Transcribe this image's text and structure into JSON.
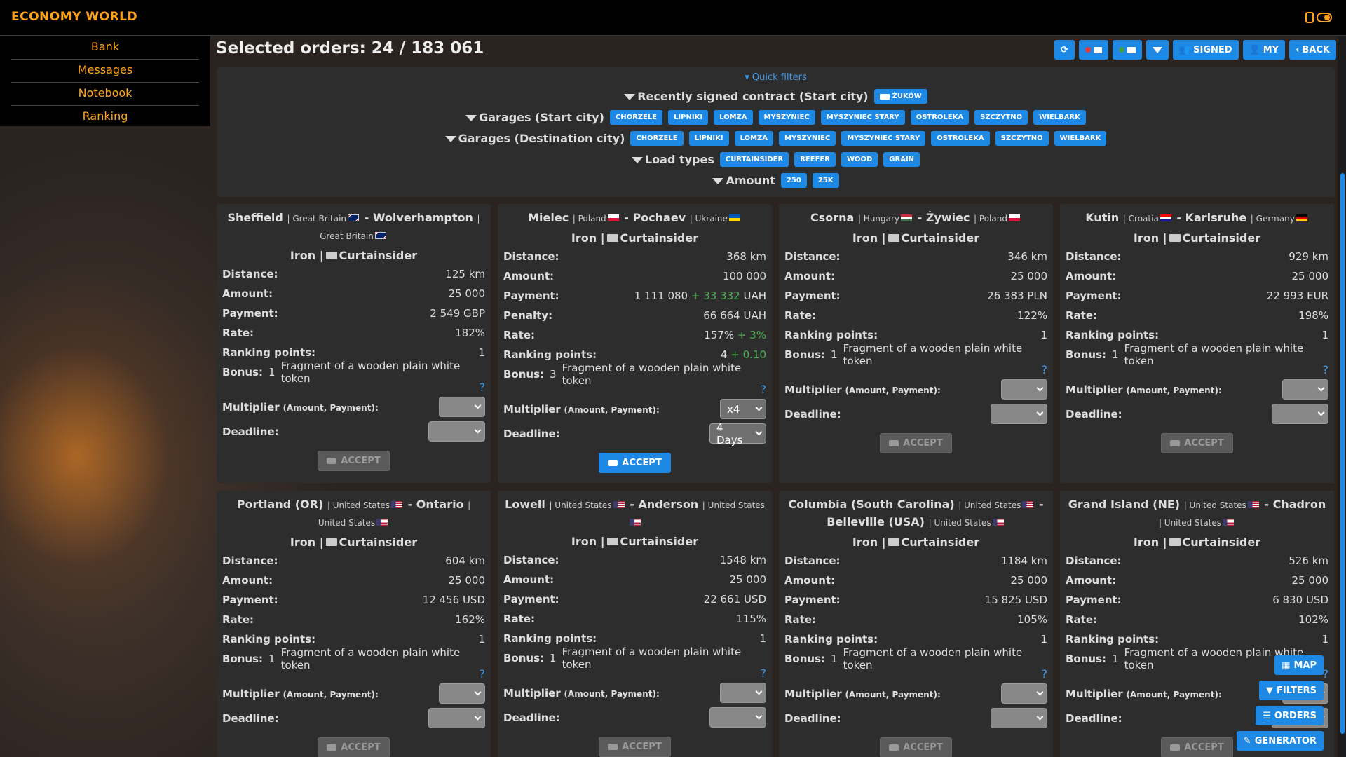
{
  "brand": "ECONOMY WORLD",
  "menu": [
    "Bank",
    "Messages",
    "Notebook",
    "Ranking"
  ],
  "title": "Selected orders: 24 / 183 061",
  "buttons": {
    "signed": "SIGNED",
    "my": "MY",
    "back": "BACK"
  },
  "quick_filters": {
    "toggle": "Quick filters",
    "recent_label": "Recently signed contract (Start city)",
    "recent_chip": "ŻUKÓW",
    "garages_start_label": "Garages (Start city)",
    "garages_start": [
      "CHORZELE",
      "LIPNIKI",
      "LOMZA",
      "MYSZYNIEC",
      "MYSZYNIEC STARY",
      "OSTROLEKA",
      "SZCZYTNO",
      "WIELBARK"
    ],
    "garages_dest_label": "Garages (Destination city)",
    "garages_dest": [
      "CHORZELE",
      "LIPNIKI",
      "LOMZA",
      "MYSZYNIEC",
      "MYSZYNIEC STARY",
      "OSTROLEKA",
      "SZCZYTNO",
      "WIELBARK"
    ],
    "load_label": "Load types",
    "load_types": [
      "CURTAINSIDER",
      "REEFER",
      "WOOD",
      "GRAIN"
    ],
    "amount_label": "Amount",
    "amounts": [
      "250",
      "25K"
    ]
  },
  "labels": {
    "distance": "Distance:",
    "amount": "Amount:",
    "payment": "Payment:",
    "penalty": "Penalty:",
    "rate": "Rate:",
    "ranking": "Ranking points:",
    "bonus": "Bonus:",
    "multiplier": "Multiplier",
    "multiplier_sub": "(Amount, Payment):",
    "deadline": "Deadline:",
    "accept": "ACCEPT",
    "qmark": "?"
  },
  "cards": [
    {
      "from": "Sheffield",
      "from_country": "Great Britain",
      "from_flag": "gb",
      "to": "Wolverhampton",
      "to_country": "Great Britain",
      "to_flag": "gb",
      "cargo": "Iron",
      "trailer": "Curtainsider",
      "distance": "125 km",
      "amount": "25 000",
      "payment": "2 549",
      "payment_plus": "",
      "currency": "GBP",
      "penalty": "",
      "rate": "182%",
      "rate_plus": "",
      "ranking": "1",
      "ranking_plus": "",
      "bonus_qty": "1",
      "bonus": "Fragment of a wooden plain white token",
      "multiplier": "",
      "deadline": "",
      "accept_enabled": false
    },
    {
      "from": "Mielec",
      "from_country": "Poland",
      "from_flag": "pl",
      "to": "Pochaev",
      "to_country": "Ukraine",
      "to_flag": "ua",
      "cargo": "Iron",
      "trailer": "Curtainsider",
      "distance": "368 km",
      "amount": "100 000",
      "payment": "1 111 080",
      "payment_plus": "+ 33 332",
      "currency": "UAH",
      "penalty": "66 664 UAH",
      "rate": "157%",
      "rate_plus": "+ 3%",
      "ranking": "4",
      "ranking_plus": "+ 0.10",
      "bonus_qty": "3",
      "bonus": "Fragment of a wooden plain white token",
      "multiplier": "x4",
      "deadline": "4 Days",
      "accept_enabled": true
    },
    {
      "from": "Csorna",
      "from_country": "Hungary",
      "from_flag": "hu",
      "to": "Żywiec",
      "to_country": "Poland",
      "to_flag": "pl",
      "cargo": "Iron",
      "trailer": "Curtainsider",
      "distance": "346 km",
      "amount": "25 000",
      "payment": "26 383",
      "payment_plus": "",
      "currency": "PLN",
      "penalty": "",
      "rate": "122%",
      "rate_plus": "",
      "ranking": "1",
      "ranking_plus": "",
      "bonus_qty": "1",
      "bonus": "Fragment of a wooden plain white token",
      "multiplier": "",
      "deadline": "",
      "accept_enabled": false
    },
    {
      "from": "Kutin",
      "from_country": "Croatia",
      "from_flag": "hr",
      "to": "Karlsruhe",
      "to_country": "Germany",
      "to_flag": "de",
      "cargo": "Iron",
      "trailer": "Curtainsider",
      "distance": "929 km",
      "amount": "25 000",
      "payment": "22 993",
      "payment_plus": "",
      "currency": "EUR",
      "penalty": "",
      "rate": "198%",
      "rate_plus": "",
      "ranking": "1",
      "ranking_plus": "",
      "bonus_qty": "1",
      "bonus": "Fragment of a wooden plain white token",
      "multiplier": "",
      "deadline": "",
      "accept_enabled": false
    },
    {
      "from": "Portland (OR)",
      "from_country": "United States",
      "from_flag": "us",
      "to": "Ontario",
      "to_country": "United States",
      "to_flag": "us",
      "cargo": "Iron",
      "trailer": "Curtainsider",
      "distance": "604 km",
      "amount": "25 000",
      "payment": "12 456",
      "payment_plus": "",
      "currency": "USD",
      "penalty": "",
      "rate": "162%",
      "rate_plus": "",
      "ranking": "1",
      "ranking_plus": "",
      "bonus_qty": "1",
      "bonus": "Fragment of a wooden plain white token",
      "multiplier": "",
      "deadline": "",
      "accept_enabled": false
    },
    {
      "from": "Lowell",
      "from_country": "United States",
      "from_flag": "us",
      "to": "Anderson",
      "to_country": "United States",
      "to_flag": "us",
      "cargo": "Iron",
      "trailer": "Curtainsider",
      "distance": "1548 km",
      "amount": "25 000",
      "payment": "22 661",
      "payment_plus": "",
      "currency": "USD",
      "penalty": "",
      "rate": "115%",
      "rate_plus": "",
      "ranking": "1",
      "ranking_plus": "",
      "bonus_qty": "1",
      "bonus": "Fragment of a wooden plain white token",
      "multiplier": "",
      "deadline": "",
      "accept_enabled": false
    },
    {
      "from": "Columbia (South Carolina)",
      "from_country": "United States",
      "from_flag": "us",
      "to": "Belleville (USA)",
      "to_country": "United States",
      "to_flag": "us",
      "cargo": "Iron",
      "trailer": "Curtainsider",
      "distance": "1184 km",
      "amount": "25 000",
      "payment": "15 825",
      "payment_plus": "",
      "currency": "USD",
      "penalty": "",
      "rate": "105%",
      "rate_plus": "",
      "ranking": "1",
      "ranking_plus": "",
      "bonus_qty": "1",
      "bonus": "Fragment of a wooden plain white token",
      "multiplier": "",
      "deadline": "",
      "accept_enabled": false
    },
    {
      "from": "Grand Island (NE)",
      "from_country": "United States",
      "from_flag": "us",
      "to": "Chadron",
      "to_country": "United States",
      "to_flag": "us",
      "cargo": "Iron",
      "trailer": "Curtainsider",
      "distance": "526 km",
      "amount": "25 000",
      "payment": "6 830",
      "payment_plus": "",
      "currency": "USD",
      "penalty": "",
      "rate": "102%",
      "rate_plus": "",
      "ranking": "1",
      "ranking_plus": "",
      "bonus_qty": "1",
      "bonus": "Fragment of a wooden plain white token",
      "multiplier": "",
      "deadline": "",
      "accept_enabled": false
    }
  ],
  "floating": {
    "map": "MAP",
    "filters": "FILTERS",
    "orders": "ORDERS",
    "generator": "GENERATOR"
  },
  "colors": {
    "accent": "#ffa31a",
    "primary_button": "#1e88e5",
    "bonus_green": "#4caf50",
    "penalty_yellow": "#ffb300"
  }
}
